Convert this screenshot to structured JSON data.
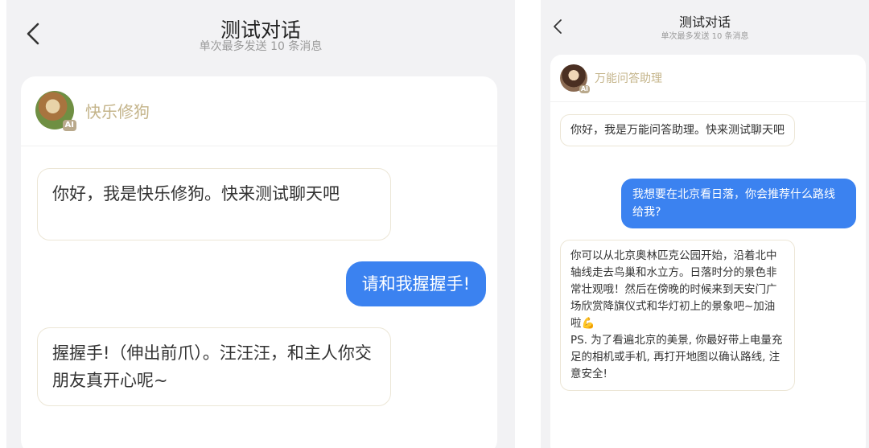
{
  "left_screen": {
    "header": {
      "title": "测试对话",
      "subtitle": "单次最多发送 10 条消息"
    },
    "bot": {
      "name": "快乐修狗",
      "avatar_tag": "AI"
    },
    "messages": [
      {
        "role": "bot",
        "text": "你好，我是快乐修狗。快来测试聊天吧"
      },
      {
        "role": "user",
        "text": "请和我握握手!"
      },
      {
        "role": "bot",
        "text": "握握手!（伸出前爪）。汪汪汪，和主人你交朋友真开心呢~"
      }
    ]
  },
  "right_screen": {
    "header": {
      "title": "测试对话",
      "subtitle": "单次最多发送 10 条消息"
    },
    "bot": {
      "name": "万能问答助理",
      "avatar_tag": "AI"
    },
    "messages": [
      {
        "role": "bot",
        "text": "你好，我是万能问答助理。快来测试聊天吧"
      },
      {
        "role": "user",
        "text": "我想要在北京看日落，你会推荐什么路线给我?"
      },
      {
        "role": "bot",
        "text": "你可以从北京奥林匹克公园开始，沿着北中轴线走去鸟巢和水立方。日落时分的景色非常壮观哦！然后在傍晚的时候来到天安门广场欣赏降旗仪式和华灯初上的景象吧~加油啦💪\nPS. 为了看遍北京的美景, 你最好带上电量充足的相机或手机, 再打开地图以确认路线, 注意安全!"
      }
    ]
  },
  "colors": {
    "background": "#f2f2f4",
    "user_bubble": "#3b82f0",
    "bot_name": "#c4b48a",
    "bot_bubble_border": "#ece6d6"
  },
  "icons": {
    "back": "chevron-left-icon",
    "avatar_badge": "ai-badge"
  }
}
